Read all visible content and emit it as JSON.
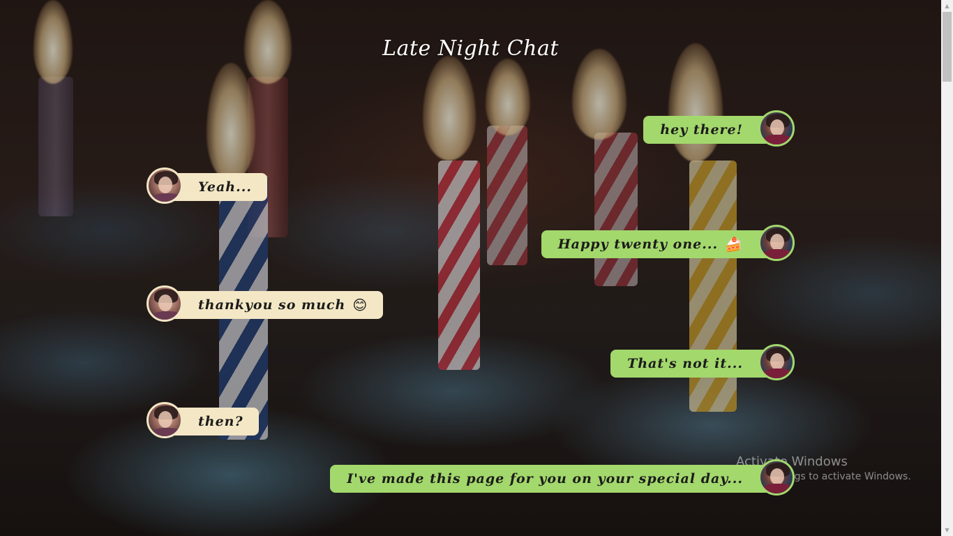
{
  "page": {
    "title": "Late Night Chat"
  },
  "colors": {
    "sent_bubble": "#a3d86c",
    "received_bubble": "#f4e7c5",
    "title_text": "#ffffff",
    "message_text": "#1b1b1b"
  },
  "messages": [
    {
      "side": "right",
      "sender": "him",
      "text": "hey there!",
      "emoji": ""
    },
    {
      "side": "left",
      "sender": "her",
      "text": "Yeah...",
      "emoji": ""
    },
    {
      "side": "right",
      "sender": "him",
      "text": "Happy twenty one...",
      "emoji": "🍰"
    },
    {
      "side": "left",
      "sender": "her",
      "text": "thankyou so much",
      "emoji": "😊"
    },
    {
      "side": "right",
      "sender": "him",
      "text": "That's not it...",
      "emoji": ""
    },
    {
      "side": "left",
      "sender": "her",
      "text": "then?",
      "emoji": ""
    },
    {
      "side": "right",
      "sender": "him",
      "text": "I've made this page for you on your special day...",
      "emoji": ""
    }
  ],
  "watermark": {
    "line1": "Activate Windows",
    "line2": "Go to Settings to activate Windows."
  },
  "icons": {
    "scroll_up": "triangle-up-icon",
    "scroll_down": "triangle-down-icon"
  }
}
